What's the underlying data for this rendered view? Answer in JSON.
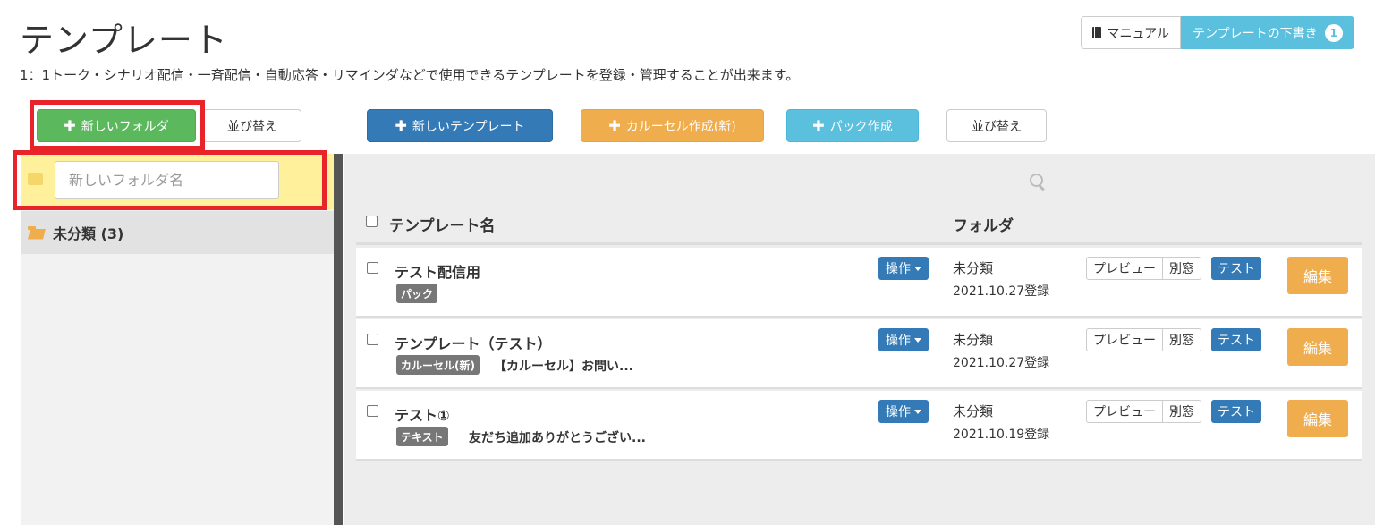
{
  "page": {
    "title": "テンプレート",
    "description": "1：1トーク・シナリオ配信・一斉配信・自動応答・リマインダなどで使用できるテンプレートを登録・管理することが出来ます。"
  },
  "top_right": {
    "manual_label": "マニュアル",
    "draft_label": "テンプレートの下書き",
    "draft_count": "1"
  },
  "folder_toolbar": {
    "new_folder_label": "新しいフォルダ",
    "sort_label": "並び替え"
  },
  "template_toolbar": {
    "new_template_label": "新しいテンプレート",
    "carousel_label": "カルーセル作成(新)",
    "pack_label": "パック作成",
    "sort_label": "並び替え"
  },
  "folder_panel": {
    "new_folder_placeholder": "新しいフォルダ名",
    "folders": [
      {
        "label": "未分類 (3)"
      }
    ]
  },
  "table": {
    "header_name": "テンプレート名",
    "header_folder": "フォルダ",
    "rows": [
      {
        "title": "テスト配信用",
        "type": "パック",
        "subtitle": "",
        "op_label": "操作",
        "folder": "未分類",
        "date": "2021.10.27登録",
        "preview": "プレビュー",
        "new_window": "別窓",
        "test": "テスト",
        "edit": "編集"
      },
      {
        "title": "テンプレート（テスト）",
        "type": "カルーセル(新)",
        "subtitle": "【カルーセル】お問い...",
        "op_label": "操作",
        "folder": "未分類",
        "date": "2021.10.27登録",
        "preview": "プレビュー",
        "new_window": "別窓",
        "test": "テスト",
        "edit": "編集"
      },
      {
        "title": "テスト①",
        "type": "テキスト",
        "subtitle": "友だち追加ありがとうござい...",
        "op_label": "操作",
        "folder": "未分類",
        "date": "2021.10.19登録",
        "preview": "プレビュー",
        "new_window": "別窓",
        "test": "テスト",
        "edit": "編集"
      }
    ]
  },
  "colors": {
    "highlight_box": "#e8232a",
    "new_folder_row": "#fff09b",
    "primary": "#337ab7",
    "success": "#5cb85c",
    "warning": "#f0ad4e",
    "info": "#5bc0de"
  }
}
